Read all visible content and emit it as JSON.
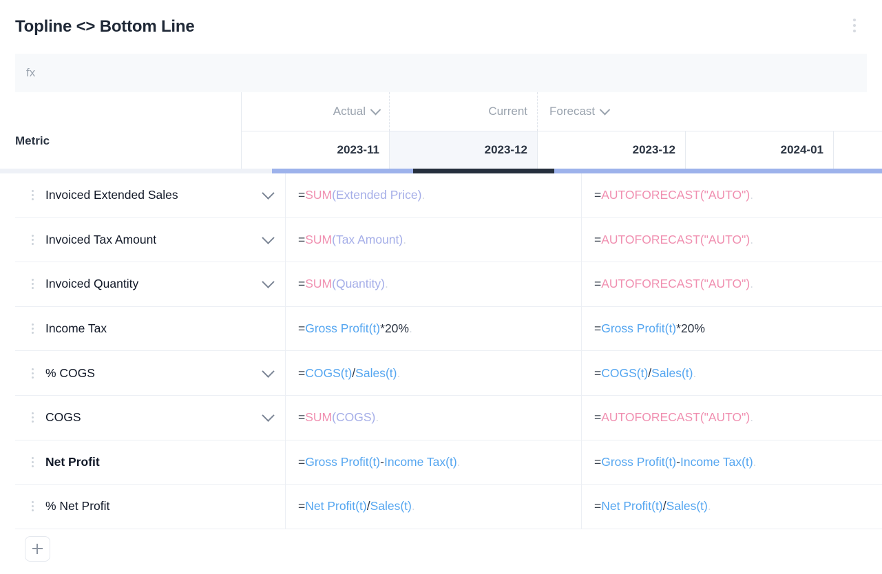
{
  "window": {
    "title": "Topline <> Bottom Line",
    "menu_icon": "kebab-menu-icon"
  },
  "formula_bar": {
    "placeholder": "fx",
    "value": ""
  },
  "table": {
    "metric_column_header": "Metric",
    "column_groups": [
      {
        "label": "Actual",
        "has_chevron": true,
        "accent": "#9db2eb"
      },
      {
        "label": "Current",
        "has_chevron": false,
        "accent": "#252f3d"
      },
      {
        "label": "Forecast",
        "has_chevron": true,
        "accent": "#9db2eb"
      }
    ],
    "date_columns": [
      {
        "label": "2023-11",
        "group": "Actual",
        "selected": false
      },
      {
        "label": "2023-12",
        "group": "Current",
        "selected": true
      },
      {
        "label": "2023-12",
        "group": "Forecast",
        "selected": false
      },
      {
        "label": "2024-01",
        "group": "Forecast",
        "selected": false
      }
    ],
    "rows": [
      {
        "metric": "Invoiced Extended Sales",
        "bold": false,
        "has_chevron": true,
        "actual_formula": [
          {
            "t": "=",
            "c": "eq"
          },
          {
            "t": "SUM",
            "c": "fn"
          },
          {
            "t": "(Extended Price)",
            "c": "arg"
          },
          {
            "t": ".",
            "c": "dot"
          }
        ],
        "forecast_formula": [
          {
            "t": "=",
            "c": "eq"
          },
          {
            "t": "AUTOFORECAST(\"AUTO\")",
            "c": "fn"
          },
          {
            "t": ".",
            "c": "dot"
          }
        ]
      },
      {
        "metric": "Invoiced Tax Amount",
        "bold": false,
        "has_chevron": true,
        "actual_formula": [
          {
            "t": "=",
            "c": "eq"
          },
          {
            "t": "SUM",
            "c": "fn"
          },
          {
            "t": "(Tax Amount)",
            "c": "arg"
          },
          {
            "t": ".",
            "c": "dot"
          }
        ],
        "forecast_formula": [
          {
            "t": "=",
            "c": "eq"
          },
          {
            "t": "AUTOFORECAST(\"AUTO\")",
            "c": "fn"
          },
          {
            "t": ".",
            "c": "dot"
          }
        ]
      },
      {
        "metric": "Invoiced Quantity",
        "bold": false,
        "has_chevron": true,
        "actual_formula": [
          {
            "t": "=",
            "c": "eq"
          },
          {
            "t": "SUM",
            "c": "fn"
          },
          {
            "t": "(Quantity)",
            "c": "arg"
          },
          {
            "t": ".",
            "c": "dot"
          }
        ],
        "forecast_formula": [
          {
            "t": "=",
            "c": "eq"
          },
          {
            "t": "AUTOFORECAST(\"AUTO\")",
            "c": "fn"
          },
          {
            "t": ".",
            "c": "dot"
          }
        ]
      },
      {
        "metric": "Income Tax",
        "bold": false,
        "has_chevron": false,
        "actual_formula": [
          {
            "t": "=",
            "c": "eq"
          },
          {
            "t": "Gross Profit(t)",
            "c": "ref"
          },
          {
            "t": "*20%",
            "c": "op"
          },
          {
            "t": ".",
            "c": "dot"
          }
        ],
        "forecast_formula": [
          {
            "t": "=",
            "c": "eq"
          },
          {
            "t": "Gross Profit(t)",
            "c": "ref"
          },
          {
            "t": "*20%",
            "c": "op"
          }
        ]
      },
      {
        "metric": "% COGS",
        "bold": false,
        "has_chevron": true,
        "actual_formula": [
          {
            "t": "=",
            "c": "eq"
          },
          {
            "t": "COGS(t)",
            "c": "ref"
          },
          {
            "t": "/",
            "c": "op"
          },
          {
            "t": "Sales(t)",
            "c": "ref"
          },
          {
            "t": ".",
            "c": "dot"
          }
        ],
        "forecast_formula": [
          {
            "t": "=",
            "c": "eq"
          },
          {
            "t": "COGS(t)",
            "c": "ref"
          },
          {
            "t": "/",
            "c": "op"
          },
          {
            "t": "Sales(t)",
            "c": "ref"
          },
          {
            "t": ".",
            "c": "dot"
          }
        ]
      },
      {
        "metric": "COGS",
        "bold": false,
        "has_chevron": true,
        "actual_formula": [
          {
            "t": "=",
            "c": "eq"
          },
          {
            "t": "SUM",
            "c": "fn"
          },
          {
            "t": "(COGS)",
            "c": "arg"
          },
          {
            "t": ".",
            "c": "dot"
          }
        ],
        "forecast_formula": [
          {
            "t": "=",
            "c": "eq"
          },
          {
            "t": "AUTOFORECAST(\"AUTO\")",
            "c": "fn"
          },
          {
            "t": ".",
            "c": "dot"
          }
        ]
      },
      {
        "metric": "Net Profit",
        "bold": true,
        "has_chevron": false,
        "actual_formula": [
          {
            "t": "=",
            "c": "eq"
          },
          {
            "t": "Gross Profit(t)",
            "c": "ref"
          },
          {
            "t": "-",
            "c": "op"
          },
          {
            "t": "Income Tax(t)",
            "c": "ref"
          },
          {
            "t": ".",
            "c": "dot"
          }
        ],
        "forecast_formula": [
          {
            "t": "=",
            "c": "eq"
          },
          {
            "t": "Gross Profit(t)",
            "c": "ref"
          },
          {
            "t": "-",
            "c": "op"
          },
          {
            "t": "Income Tax(t)",
            "c": "ref"
          },
          {
            "t": ".",
            "c": "dot"
          }
        ]
      },
      {
        "metric": "% Net Profit",
        "bold": false,
        "has_chevron": false,
        "actual_formula": [
          {
            "t": "=",
            "c": "eq"
          },
          {
            "t": "Net Profit(t)",
            "c": "ref"
          },
          {
            "t": "/",
            "c": "op"
          },
          {
            "t": "Sales(t)",
            "c": "ref"
          },
          {
            "t": ".",
            "c": "dot"
          }
        ],
        "forecast_formula": [
          {
            "t": "=",
            "c": "eq"
          },
          {
            "t": "Net Profit(t)",
            "c": "ref"
          },
          {
            "t": "/",
            "c": "op"
          },
          {
            "t": "Sales(t)",
            "c": "ref"
          },
          {
            "t": ".",
            "c": "dot"
          }
        ]
      }
    ]
  },
  "footer": {
    "add_row_icon": "plus-icon"
  }
}
